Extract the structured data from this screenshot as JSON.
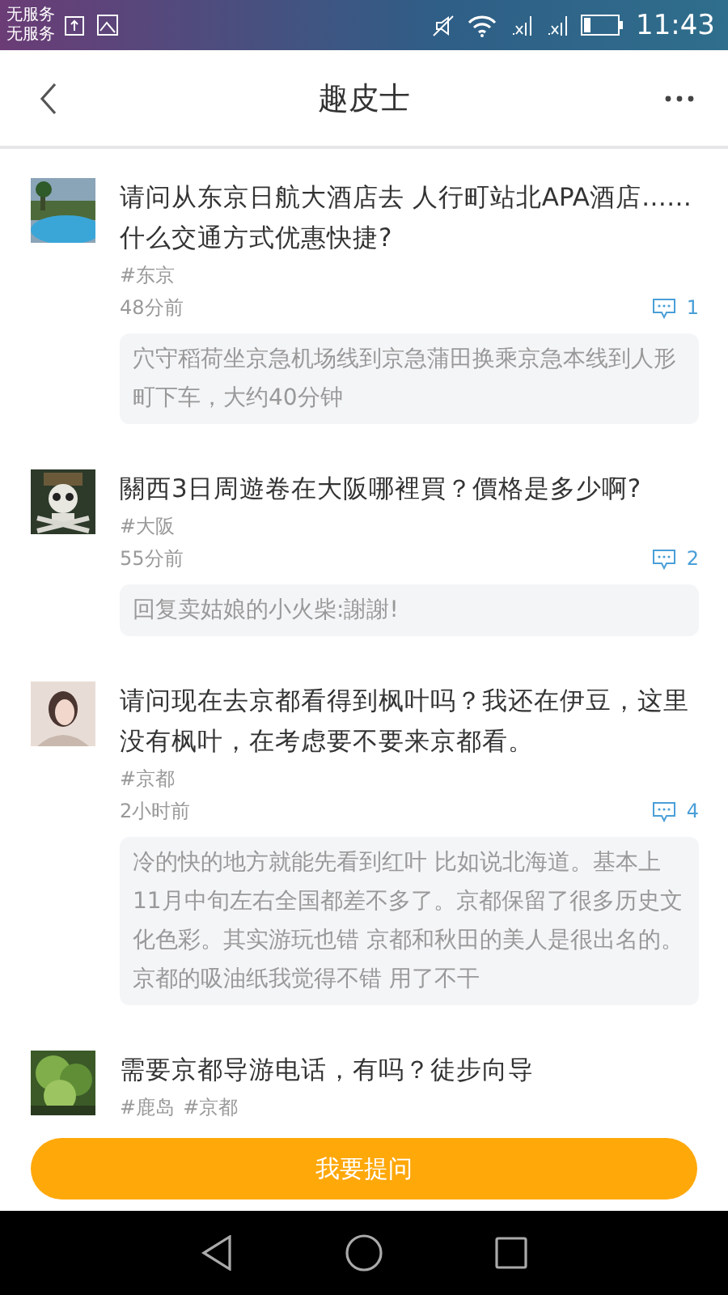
{
  "status_bar": {
    "carrier_lines": [
      "无服务",
      "无服务"
    ],
    "time": "11:43"
  },
  "header": {
    "title": "趣皮士"
  },
  "questions": [
    {
      "avatar": {
        "kind": "picture"
      },
      "title": "请问从东京日航大酒店去 人行町站北APA酒店……什么交通方式优惠快捷?",
      "tags": [
        "#东京"
      ],
      "time": "48分前",
      "replies": "1",
      "answer": "穴守稻荷坐京急机场线到京急蒲田换乘京急本线到人形町下车，大约40分钟"
    },
    {
      "avatar": {
        "kind": "picture"
      },
      "title": "關西3日周遊卷在大阪哪裡買？價格是多少啊?",
      "tags": [
        "#大阪"
      ],
      "time": "55分前",
      "replies": "2",
      "answer": "回复卖姑娘的小火柴:謝謝!"
    },
    {
      "avatar": {
        "kind": "picture"
      },
      "title": "请问现在去京都看得到枫叶吗？我还在伊豆，这里没有枫叶，在考虑要不要来京都看。",
      "tags": [
        "#京都"
      ],
      "time": "2小时前",
      "replies": "4",
      "answer": "冷的快的地方就能先看到红叶 比如说北海道。基本上11月中旬左右全国都差不多了。京都保留了很多历史文化色彩。其实游玩也错 京都和秋田的美人是很出名的。京都的吸油纸我觉得不错 用了不干"
    },
    {
      "avatar": {
        "kind": "picture"
      },
      "title": "需要京都导游电话，有吗？徒步向导",
      "tags": [
        "#鹿岛",
        "#京都"
      ]
    }
  ],
  "ask_button": "我要提问"
}
